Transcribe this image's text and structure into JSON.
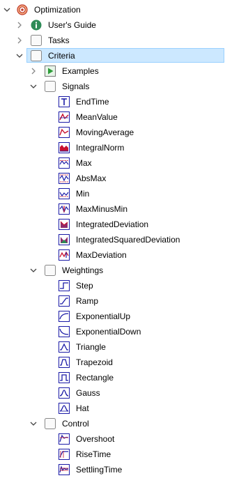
{
  "tree": {
    "optimization": {
      "label": "Optimization",
      "icon": "target-icon"
    },
    "users_guide": {
      "label": "User's Guide",
      "icon": "info-icon"
    },
    "tasks": {
      "label": "Tasks",
      "icon": "package-icon"
    },
    "criteria": {
      "label": "Criteria",
      "icon": "package-icon"
    },
    "examples": {
      "label": "Examples",
      "icon": "play-icon"
    },
    "signals": {
      "label": "Signals",
      "icon": "package-icon",
      "items": [
        {
          "label": "EndTime",
          "icon": "time-block-icon"
        },
        {
          "label": "MeanValue",
          "icon": "signal-block-icon"
        },
        {
          "label": "MovingAverage",
          "icon": "signal-block-icon"
        },
        {
          "label": "IntegralNorm",
          "icon": "signal-block-icon"
        },
        {
          "label": "Max",
          "icon": "signal-block-icon"
        },
        {
          "label": "AbsMax",
          "icon": "signal-block-icon"
        },
        {
          "label": "Min",
          "icon": "signal-block-icon"
        },
        {
          "label": "MaxMinusMin",
          "icon": "signal-block-icon"
        },
        {
          "label": "IntegratedDeviation",
          "icon": "signal-block-icon"
        },
        {
          "label": "IntegratedSquaredDeviation",
          "icon": "signal-block-icon"
        },
        {
          "label": "MaxDeviation",
          "icon": "signal-block-icon"
        }
      ]
    },
    "weightings": {
      "label": "Weightings",
      "icon": "package-icon",
      "items": [
        {
          "label": "Step",
          "icon": "step-block-icon"
        },
        {
          "label": "Ramp",
          "icon": "ramp-block-icon"
        },
        {
          "label": "ExponentialUp",
          "icon": "exp-up-block-icon"
        },
        {
          "label": "ExponentialDown",
          "icon": "exp-down-block-icon"
        },
        {
          "label": "Triangle",
          "icon": "triangle-block-icon"
        },
        {
          "label": "Trapezoid",
          "icon": "trapezoid-block-icon"
        },
        {
          "label": "Rectangle",
          "icon": "rectangle-block-icon"
        },
        {
          "label": "Gauss",
          "icon": "gauss-block-icon"
        },
        {
          "label": "Hat",
          "icon": "hat-block-icon"
        }
      ]
    },
    "control": {
      "label": "Control",
      "icon": "package-icon",
      "items": [
        {
          "label": "Overshoot",
          "icon": "control-block-icon"
        },
        {
          "label": "RiseTime",
          "icon": "control-block-icon"
        },
        {
          "label": "SettlingTime",
          "icon": "control-block-icon"
        }
      ]
    }
  },
  "colors": {
    "selection_bg": "#cce8ff",
    "selection_border": "#99d1ff",
    "block_blue": "#1a1aa6",
    "signal_red": "#c8102e",
    "info_green": "#2e8b57"
  }
}
